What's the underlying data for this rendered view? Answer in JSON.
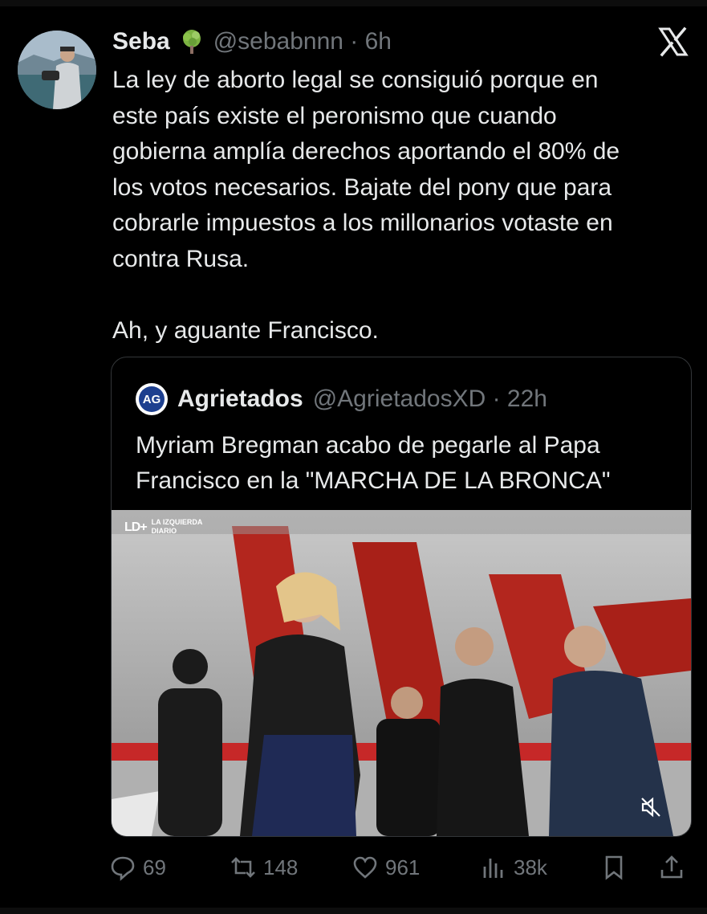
{
  "tweet": {
    "author_name": "Seba",
    "author_badge_icon": "tree-icon",
    "handle_time": "@sebabnnn · 6h",
    "text": "La ley de aborto legal se consiguió porque en\neste país existe el peronismo que cuando\ngobierna amplía derechos aportando el 80% de\nlos votos necesarios. Bajate del pony que para\ncobrarle impuestos a los millonarios votaste en\ncontra Rusa.\n\nAh, y aguante Francisco."
  },
  "quoted": {
    "logo_text": "AG",
    "author_name": "Agrietados",
    "handle_time": "@AgrietadosXD · 22h",
    "text": "Myriam Bregman acabo de pegarle al Papa\nFrancisco en la \"MARCHA DE LA BRONCA\"",
    "video": {
      "watermark_mark": "LD+",
      "watermark_line1": "LA IZQUIERDA",
      "watermark_line2": "DIARIO"
    }
  },
  "actions": {
    "replies": "69",
    "reposts": "148",
    "likes": "961",
    "views": "38k"
  },
  "colors": {
    "background": "#000000",
    "text": "#e7e9ea",
    "muted": "#71767b",
    "border": "#333639"
  }
}
